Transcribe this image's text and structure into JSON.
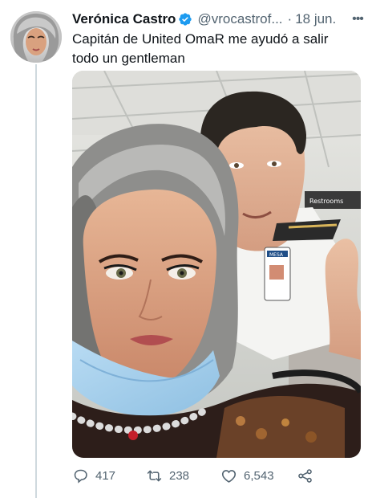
{
  "tweet": {
    "display_name": "Verónica Castro",
    "handle": "@vrocastrof...",
    "separator": "·",
    "date": "18 jun.",
    "more_glyph": "•••",
    "text_line1": "Capitán de United OmaR me ayudó a salir",
    "text_line2": "todo un gentleman",
    "media_sign_text": "Restrooms",
    "badge_text": "MESA"
  },
  "stats": {
    "replies": "417",
    "retweets": "238",
    "likes": "6,543"
  },
  "colors": {
    "verified": "#1d9bf0",
    "muted": "#536471",
    "text": "#0f1419"
  },
  "icons": {
    "verified": "verified-badge-icon",
    "more": "more-options-icon",
    "reply": "reply-icon",
    "retweet": "retweet-icon",
    "like": "like-icon",
    "share": "share-icon"
  }
}
